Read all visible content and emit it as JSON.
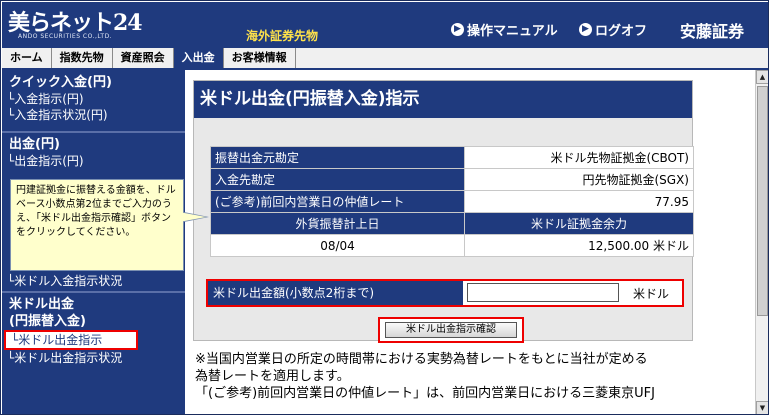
{
  "header": {
    "logo_text": "美らネット24",
    "logo_sub": "ANDO SECURITIES CO.,LTD.",
    "service_name": "海外証券先物",
    "manual_link": "操作マニュアル",
    "logoff_link": "ログオフ",
    "company": "安藤証券"
  },
  "tabs": [
    {
      "label": "ホーム",
      "active": false
    },
    {
      "label": "指数先物",
      "active": false
    },
    {
      "label": "資産照会",
      "active": false
    },
    {
      "label": "入出金",
      "active": true
    },
    {
      "label": "お客様情報",
      "active": false
    }
  ],
  "sidebar": {
    "quick_head": "クイック入金(円)",
    "quick_items": [
      "└入金指示(円)",
      "└入金指示状況(円)"
    ],
    "withdraw_head": "出金(円)",
    "withdraw_items": [
      "└出金指示(円)"
    ],
    "usd_deposit_item": "└米ドル入金指示状況",
    "usd_withdraw_head_1": "米ドル出金",
    "usd_withdraw_head_2": "(円振替入金)",
    "usd_withdraw_items": [
      "└米ドル出金指示",
      "└米ドル出金指示状況"
    ]
  },
  "tooltip": {
    "text": "円建証拠金に振替える金額を、ドルベース小数点第2位までご入力のうえ、「米ドル出金指示確認」ボタンをクリックしてください。"
  },
  "panel": {
    "title": "米ドル出金(円振替入金)指示",
    "rows": [
      {
        "label": "振替出金元勘定",
        "value": "米ドル先物証拠金(CBOT)"
      },
      {
        "label": "入金先勘定",
        "value": "円先物証拠金(SGX)"
      },
      {
        "label": "(ご参考)前回内営業日の仲値レート",
        "value": "77.95"
      }
    ],
    "col_headers": [
      "外貨振替計上日",
      "米ドル証拠金余力"
    ],
    "date_value": "08/04",
    "balance_value": "12,500.00 米ドル",
    "amount_label": "米ドル出金額(小数点2桁まで)",
    "amount_unit": "米ドル",
    "amount_value": "",
    "confirm_button": "米ドル出金指示確認"
  },
  "note": {
    "line1": "※当国内営業日の所定の時間帯における実勢為替レートをもとに当社が定める",
    "line2": "為替レートを適用します。",
    "line3": "「(ご参考)前回内営業日の仲値レート」は、前回内営業日における三菱東京UFJ"
  },
  "colors": {
    "navy": "#1f3a7e",
    "highlight_red": "#e00000",
    "tooltip_bg": "#ffffcc",
    "service_yellow": "#ffe24a"
  }
}
